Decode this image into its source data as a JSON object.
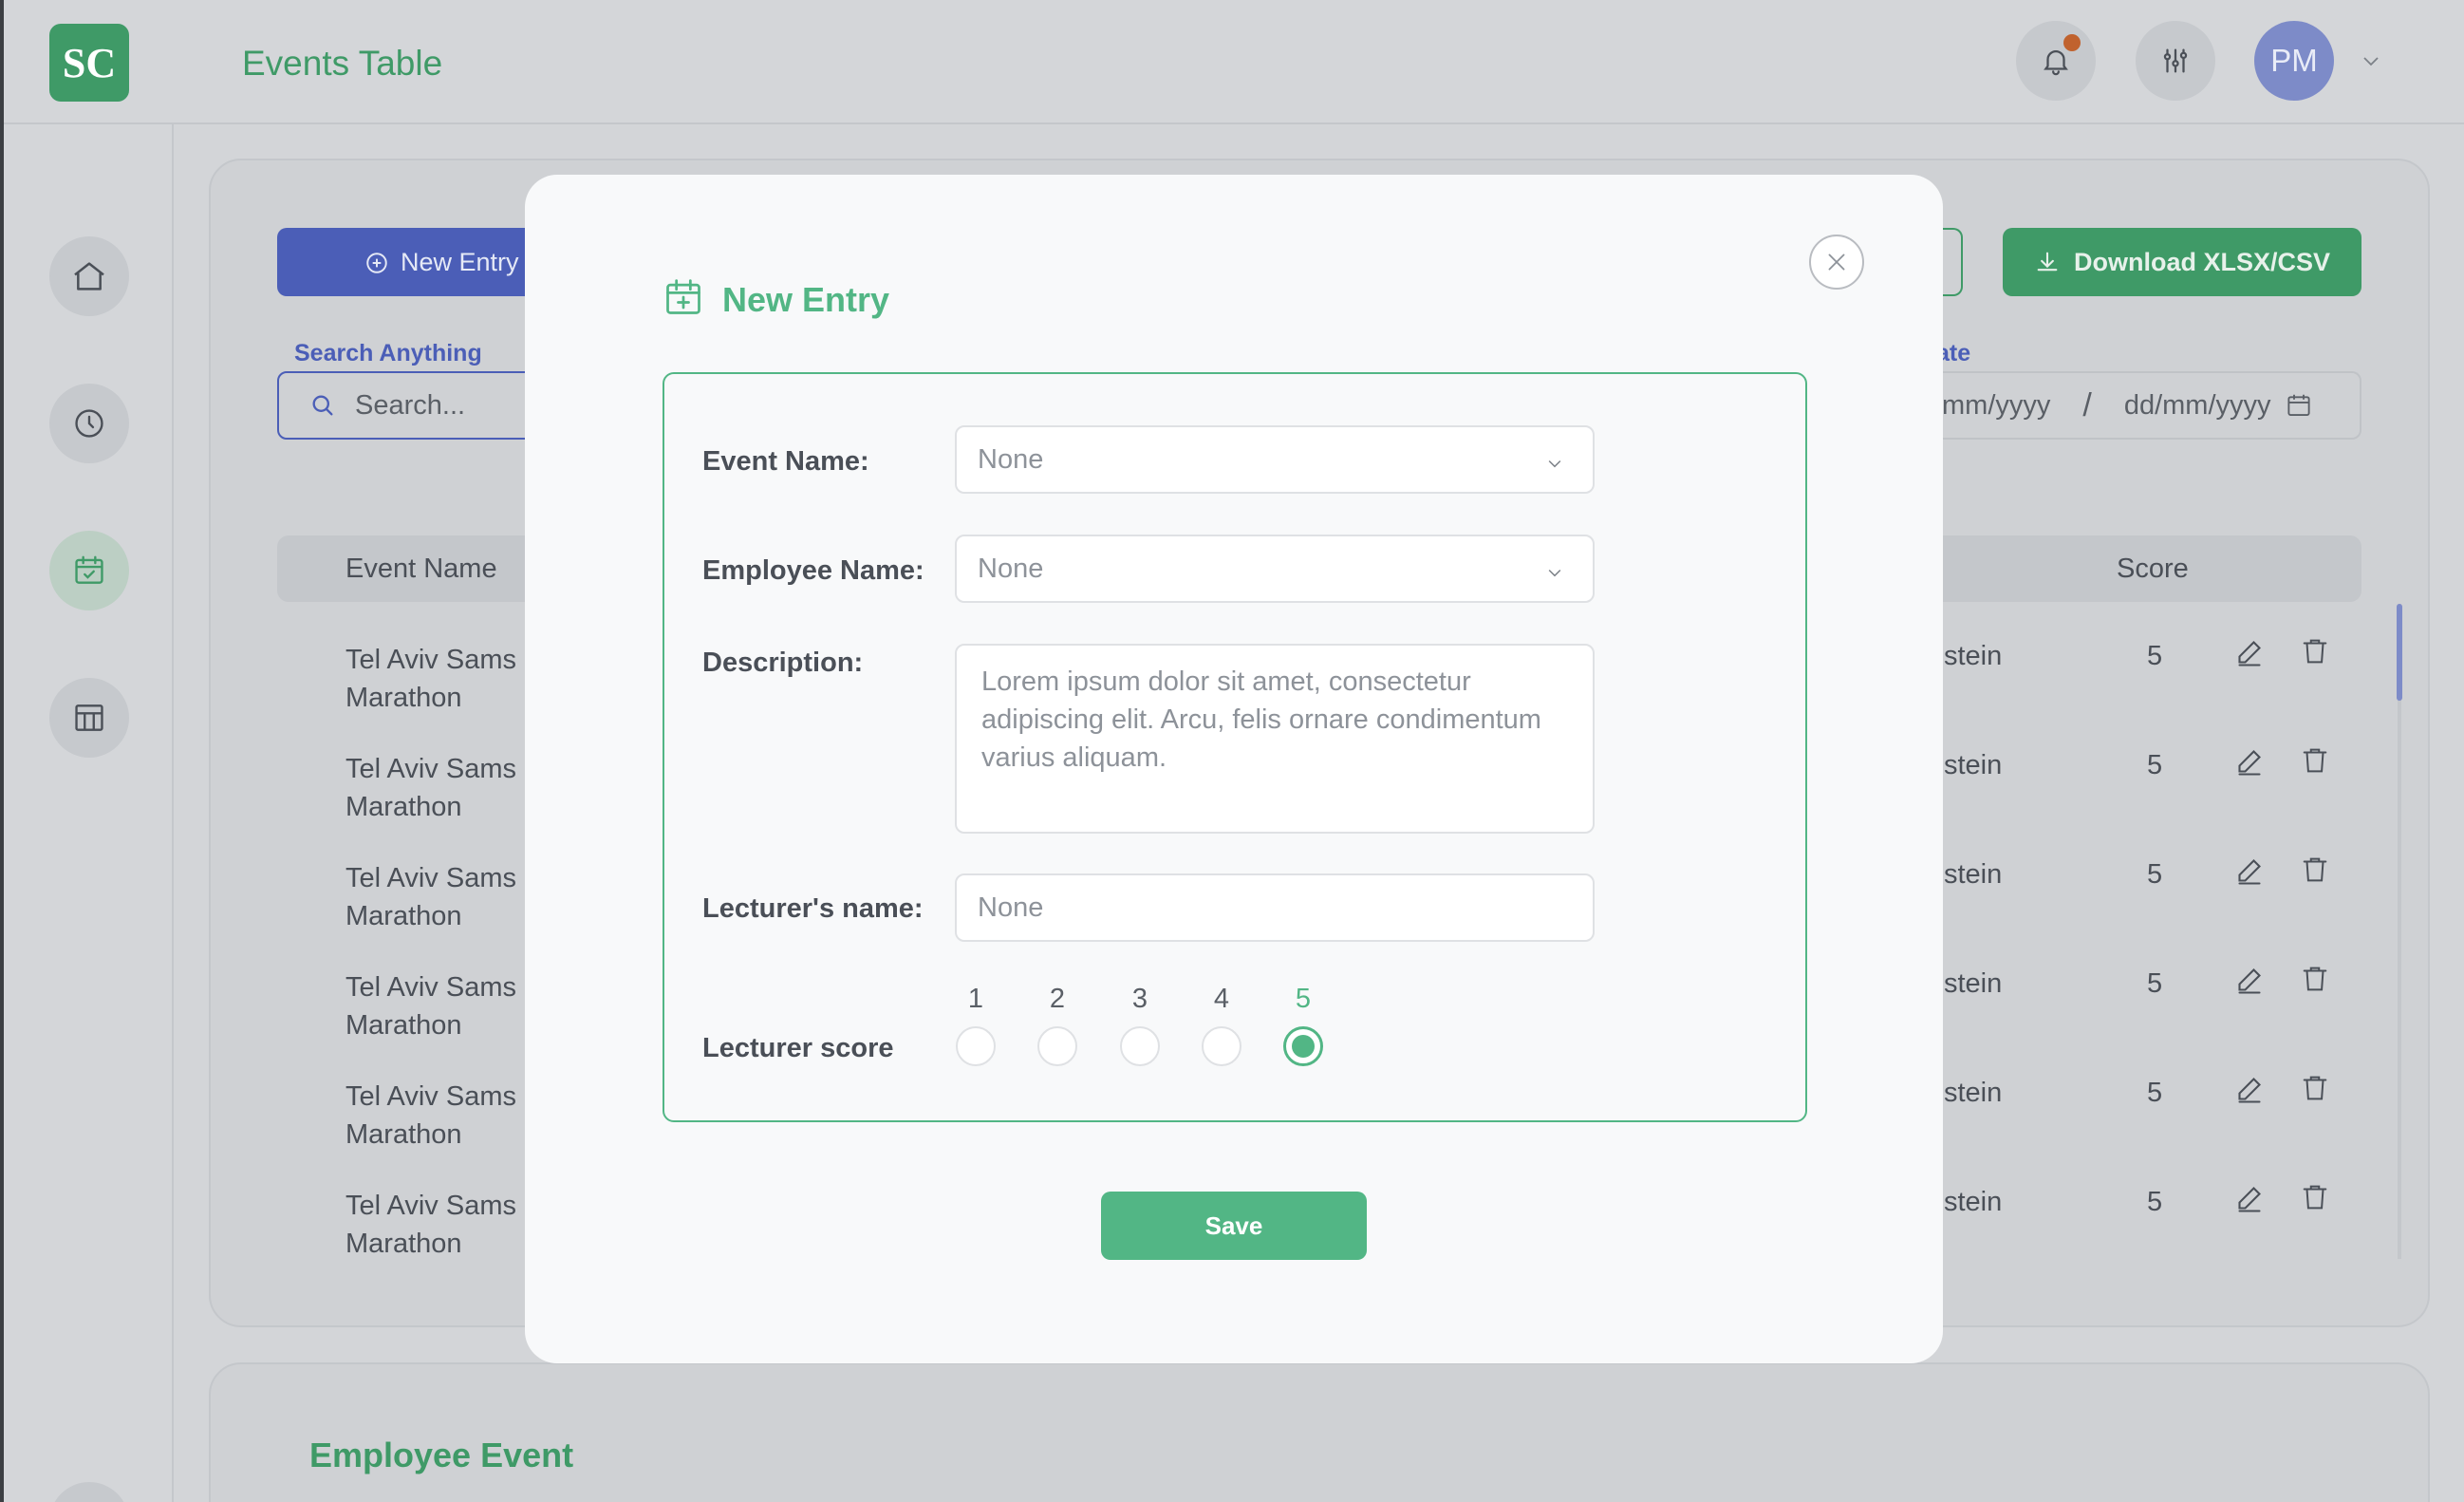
{
  "app": {
    "logo_text": "SC",
    "page_title": "Events Table",
    "avatar_initials": "PM"
  },
  "background": {
    "new_entry_label": "New Entry",
    "search_label": "Search Anything",
    "search_placeholder": "Search...",
    "download_label": "Download XLSX/CSV",
    "date_label": "ate",
    "date_from": "mm/yyyy",
    "date_sep": "/",
    "date_to": "dd/mm/yyyy",
    "table": {
      "headers": {
        "event_name": "Event Name",
        "score": "Score"
      },
      "rows": [
        {
          "name": "Tel Aviv Sams Marathon",
          "employee": "stein",
          "score": "5"
        },
        {
          "name": "Tel Aviv Sams Marathon",
          "employee": "stein",
          "score": "5"
        },
        {
          "name": "Tel Aviv Sams Marathon",
          "employee": "stein",
          "score": "5"
        },
        {
          "name": "Tel Aviv Sams Marathon",
          "employee": "stein",
          "score": "5"
        },
        {
          "name": "Tel Aviv Sams Marathon",
          "employee": "stein",
          "score": "5"
        },
        {
          "name": "Tel Aviv Sams Marathon",
          "employee": "stein",
          "score": "5"
        }
      ]
    },
    "section2_title": "Employee Event"
  },
  "modal": {
    "title": "New Entry",
    "fields": {
      "event_name": {
        "label": "Event Name:",
        "value": "None"
      },
      "employee_name": {
        "label": "Employee Name:",
        "value": "None"
      },
      "description": {
        "label": "Description:",
        "placeholder": "Lorem ipsum dolor sit amet, consectetur adipiscing elit. Arcu, felis ornare condimentum varius aliquam."
      },
      "lecturer_name": {
        "label": "Lecturer's name:",
        "placeholder": "None"
      },
      "lecturer_score": {
        "label": "Lecturer score",
        "options": [
          "1",
          "2",
          "3",
          "4",
          "5"
        ],
        "selected": "5"
      }
    },
    "save_label": "Save"
  },
  "colors": {
    "green": "#52b685",
    "dark_green": "#3f9a67",
    "blue": "#4b5eb7",
    "notification": "#c0622e"
  }
}
